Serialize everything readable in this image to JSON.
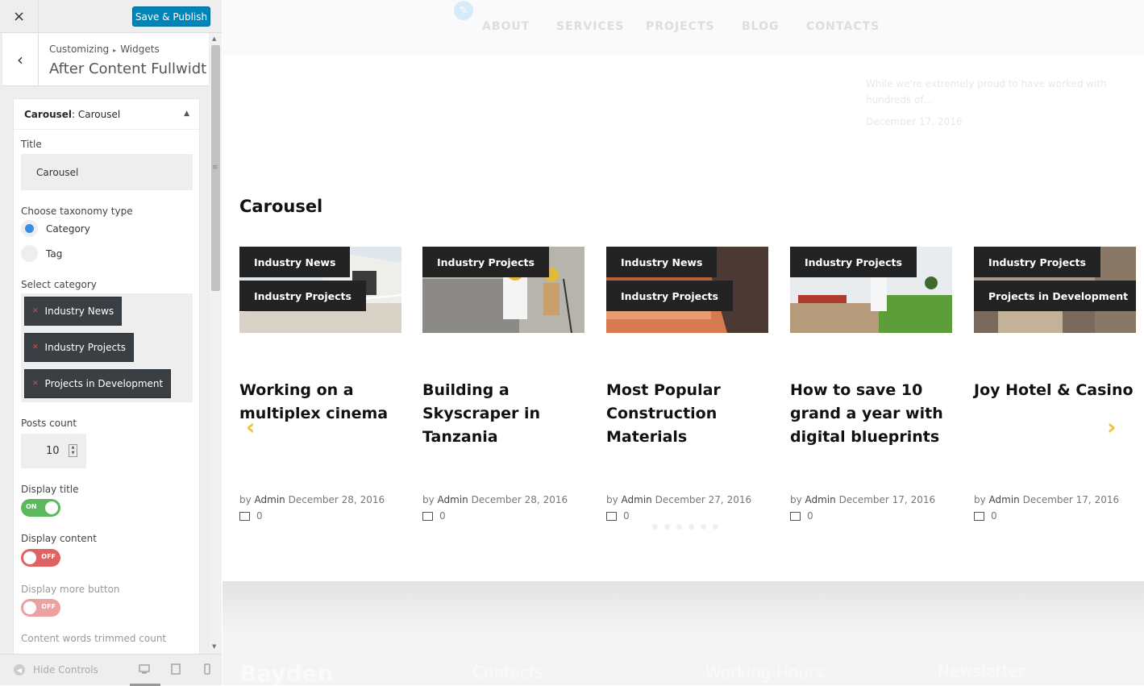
{
  "topbar": {
    "close_label": "×",
    "save_label": "Save & Publish"
  },
  "section": {
    "back_label": "‹",
    "breadcrumb_root": "Customizing",
    "breadcrumb_sep": "▸",
    "breadcrumb_leaf": "Widgets",
    "title": "After Content Fullwidt..."
  },
  "widget": {
    "type": "Carousel",
    "name": ": Carousel",
    "toggle_icon": "▲",
    "title_label": "Title",
    "title_value": "Carousel",
    "taxonomy_label": "Choose taxonomy type",
    "taxonomy_options": [
      {
        "label": "Category",
        "selected": true
      },
      {
        "label": "Tag",
        "selected": false
      }
    ],
    "category_label": "Select category",
    "selected_categories": [
      "Industry News",
      "Industry Projects",
      "Projects in Development"
    ],
    "posts_count_label": "Posts count",
    "posts_count_value": "10",
    "display_title_label": "Display title",
    "display_title_state": "ON",
    "display_content_label": "Display content",
    "display_content_state": "OFF",
    "display_more_label": "Display more button",
    "display_more_state": "OFF",
    "trim_label": "Content words trimmed count"
  },
  "footer_controls": {
    "hide_label": "Hide Controls"
  },
  "preview": {
    "nav": [
      "ABOUT",
      "SERVICES",
      "PROJECTS",
      "BLOG",
      "CONTACTS"
    ],
    "ghost_text": "While we're extremely proud to have worked with hundreds of...",
    "ghost_date": "December 17, 2016",
    "carousel_title": "Carousel",
    "cards": [
      {
        "tags": [
          "Industry News",
          "Industry Projects"
        ],
        "title": "Working on a multiplex cinema",
        "by": "by",
        "author": "Admin",
        "date": "December 28, 2016",
        "comments": "0"
      },
      {
        "tags": [
          "Industry Projects"
        ],
        "title": "Building a Skyscraper in Tanzania",
        "by": "by",
        "author": "Admin",
        "date": "December 28, 2016",
        "comments": "0"
      },
      {
        "tags": [
          "Industry News",
          "Industry Projects"
        ],
        "title": "Most Popular Construction Materials",
        "by": "by",
        "author": "Admin",
        "date": "December 27, 2016",
        "comments": "0"
      },
      {
        "tags": [
          "Industry Projects"
        ],
        "title": "How to save 10 grand a year with digital blueprints",
        "by": "by",
        "author": "Admin",
        "date": "December 17, 2016",
        "comments": "0"
      },
      {
        "tags": [
          "Industry Projects",
          "Projects in Development"
        ],
        "title": "Joy Hotel & Casino",
        "by": "by",
        "author": "Admin",
        "date": "December 17, 2016",
        "comments": "0"
      }
    ],
    "footer": {
      "logo": "Bayden",
      "col1": "Contacts",
      "col2": "Working Hours",
      "col3": "Newsletter"
    }
  },
  "colors": {
    "accent": "#0085ba",
    "tag_bg": "#232323",
    "arrow": "#f2c230",
    "toggle_on": "#5cb85c",
    "toggle_off": "#e06363"
  }
}
